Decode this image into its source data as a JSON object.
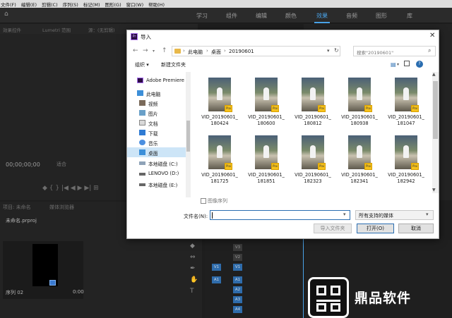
{
  "menubar": {
    "items": [
      "文件(F)",
      "编辑(E)",
      "剪辑(C)",
      "序列(S)",
      "标记(M)",
      "图形(G)",
      "窗口(W)",
      "帮助(H)"
    ]
  },
  "workspaces": {
    "items": [
      "学习",
      "组件",
      "编辑",
      "颜色",
      "效果",
      "音频",
      "图形",
      "库"
    ],
    "active": "效果"
  },
  "source_panel": {
    "tabs": [
      "效果控件",
      "Lumetri 范围",
      "源：(无剪辑)"
    ],
    "timecode": "00;00;00;00",
    "fit": "适合",
    "transport": "◆   {   }   |◀   ◀   ▶   ▶|   ⊞"
  },
  "project_panel": {
    "tabs": [
      "项目: 未命名",
      "媒体浏览器"
    ],
    "file": "未命名.prproj",
    "sequence_name": "序列 02",
    "sequence_duration": "0:00"
  },
  "timeline": {
    "tracks": [
      "V3",
      "V2",
      "V1",
      "A1",
      "A2",
      "A3",
      "A4"
    ],
    "source_v": "V1",
    "source_a": "A1"
  },
  "logo": {
    "text": "鼎品软件"
  },
  "dialog": {
    "title": "导入",
    "breadcrumb": [
      "此电脑",
      "桌面",
      "20190601"
    ],
    "search_placeholder": "搜索\"20190601\"",
    "toolbar": {
      "organize": "组织 ▾",
      "new_folder": "新建文件夹"
    },
    "nav": [
      {
        "label": "Adobe Premiere",
        "icon": "premiere-icon",
        "top": true
      },
      {
        "label": "此电脑",
        "icon": "computer-icon",
        "top": true
      },
      {
        "label": "视频",
        "icon": "videos-folder-icon"
      },
      {
        "label": "图片",
        "icon": "pictures-folder-icon"
      },
      {
        "label": "文档",
        "icon": "documents-folder-icon"
      },
      {
        "label": "下载",
        "icon": "downloads-folder-icon"
      },
      {
        "label": "音乐",
        "icon": "music-folder-icon"
      },
      {
        "label": "桌面",
        "icon": "desktop-folder-icon",
        "selected": true
      },
      {
        "label": "本地磁盘 (C:)",
        "icon": "drive-icon"
      },
      {
        "label": "LENOVO (D:)",
        "icon": "drive-icon"
      },
      {
        "label": "本地磁盘 (E:)",
        "icon": "drive-icon"
      }
    ],
    "files": [
      {
        "line1": "VID_20190601_",
        "line2": "180424"
      },
      {
        "line1": "VID_20190601_",
        "line2": "180600"
      },
      {
        "line1": "VID_20190601_",
        "line2": "180812"
      },
      {
        "line1": "VID_20190601_",
        "line2": "180938"
      },
      {
        "line1": "VID_20190601_",
        "line2": "181047"
      },
      {
        "line1": "VID_20190601_",
        "line2": "181725"
      },
      {
        "line1": "VID_20190601_",
        "line2": "181851"
      },
      {
        "line1": "VID_20190601_",
        "line2": "182323"
      },
      {
        "line1": "VID_20190601_",
        "line2": "182341"
      },
      {
        "line1": "VID_20190601_",
        "line2": "182942"
      }
    ],
    "image_sequence_label": "图像序列",
    "filename_label": "文件名(N):",
    "filename_value": "",
    "filetype_value": "所有支持的媒体",
    "buttons": {
      "import_folder": "导入文件夹",
      "open": "打开(O)",
      "cancel": "取消"
    },
    "file_badge": "Plai"
  }
}
